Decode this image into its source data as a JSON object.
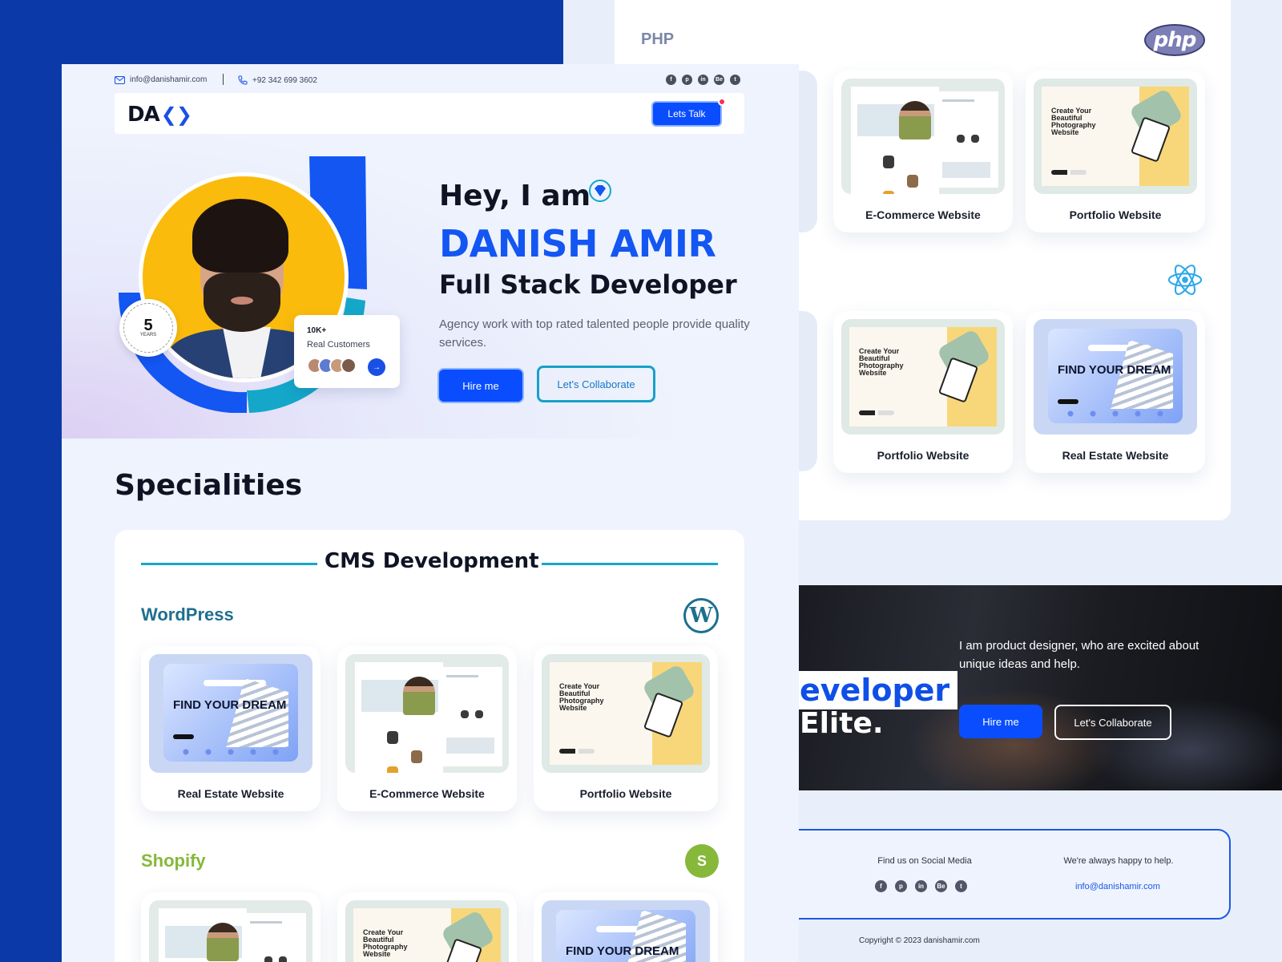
{
  "topbar": {
    "email": "info@danishamir.com",
    "phone": "+92 342 699 3602",
    "social_icons": [
      "facebook-icon",
      "pinterest-icon",
      "linkedin-icon",
      "behance-icon",
      "twitter-icon"
    ]
  },
  "navbar": {
    "logo": "DA",
    "logo_mark": "❮❯",
    "cta": "Lets Talk"
  },
  "hero": {
    "greeting": "Hey, I am",
    "name": "DANISH AMIR",
    "role": "Full Stack Developer",
    "description": "Agency work with top rated talented people provide quality services.",
    "hire_button": "Hire me",
    "collab_button": "Let's Collaborate",
    "experience_number": "5",
    "experience_unit": "YEARS",
    "customers_count": "10K+",
    "customers_label": "Real Customers"
  },
  "specialities": {
    "title": "Specialities",
    "category": "CMS Development",
    "wordpress": {
      "label": "WordPress",
      "logo": "W",
      "items": [
        "Real Estate Website",
        "E-Commerce Website",
        "Portfolio Website"
      ]
    },
    "shopify": {
      "label": "Shopify",
      "logo": "S"
    }
  },
  "thumbs": {
    "realestate_headline": "FIND YOUR DREAM",
    "portfolio_headline": "Create Your Beautiful Photography Website"
  },
  "php_section": {
    "label": "PHP",
    "logo": "php",
    "top_items": [
      "E-Commerce Website",
      "Portfolio Website"
    ],
    "react_items": [
      "Portfolio Website",
      "Real Estate Website"
    ]
  },
  "banner": {
    "big_word_1": "eveloper",
    "big_word_2": "Elite.",
    "text": "I am product designer, who are excited about unique ideas and help.",
    "hire_button": "Hire me",
    "collab_button": "Let's Collaborate"
  },
  "footer": {
    "social_title": "Find us on Social Media",
    "help_title": "We're always happy to help.",
    "email": "info@danishamir.com",
    "copyright": "Copyright © 2023 danishamir.com"
  },
  "colors": {
    "primary_blue": "#0a4dff",
    "deep_blue_bg": "#0b3aa8",
    "teal": "#14a7c9",
    "yellow": "#fbbb0c",
    "wordpress": "#1e6f8f",
    "shopify": "#86b83a"
  }
}
